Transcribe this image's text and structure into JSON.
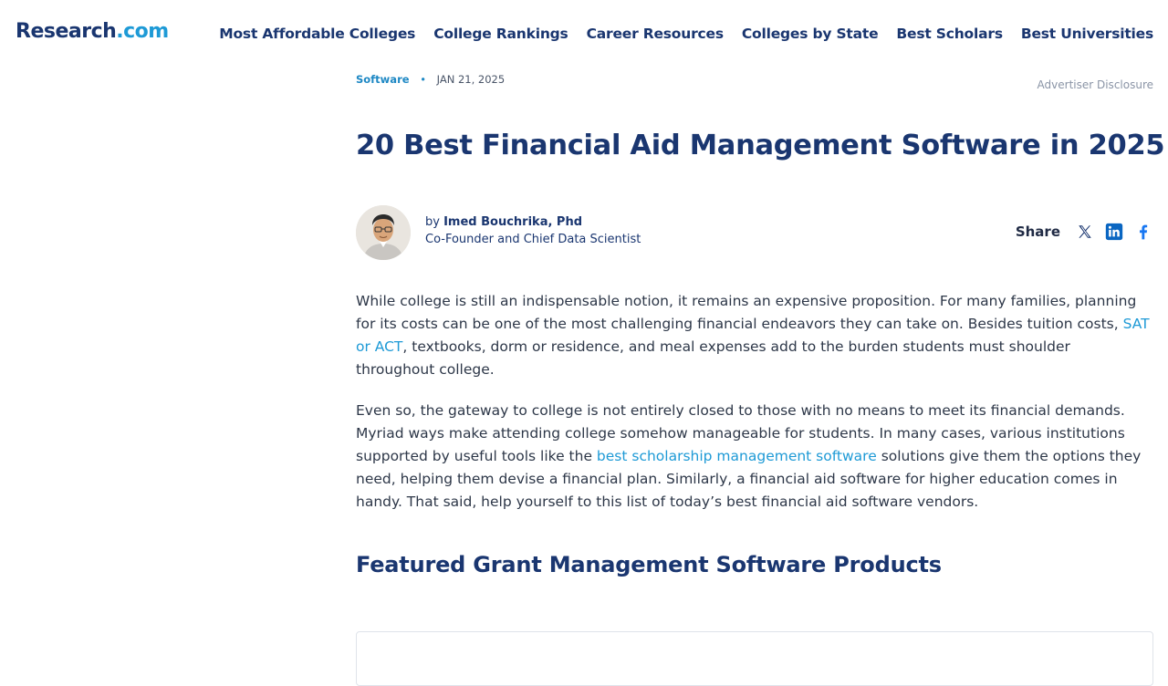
{
  "header": {
    "logo": {
      "main": "Research",
      "suffix": ".com"
    },
    "nav": [
      "Most Affordable Colleges",
      "College Rankings",
      "Career Resources",
      "Colleges by State",
      "Best Scholars",
      "Best Universities"
    ]
  },
  "article": {
    "category": "Software",
    "date": "JAN 21, 2025",
    "disclosure": "Advertiser Disclosure",
    "title": "20 Best Financial Aid Management Software in 2025",
    "author": {
      "by": "by",
      "name": "Imed Bouchrika, Phd",
      "role": "Co-Founder and Chief Data Scientist"
    },
    "share": {
      "label": "Share",
      "icons": [
        "x-twitter-icon",
        "linkedin-icon",
        "facebook-icon"
      ]
    },
    "paragraphs": {
      "p1_before": "While college is still an indispensable notion, it remains an expensive proposition. For many families, planning for its costs can be one of the most challenging financial endeavors they can take on. Besides tuition costs, ",
      "p1_link": "SAT or ACT",
      "p1_after": ", textbooks, dorm or residence, and meal expenses add to the burden students must shoulder throughout college.",
      "p2_before": "Even so, the gateway to college is not entirely closed to those with no means to meet its financial demands. Myriad ways make attending college somehow manageable for students. In many cases, various institutions supported by useful tools like the ",
      "p2_link": "best scholarship management software",
      "p2_after": " solutions give them the options they need, helping them devise a financial plan. Similarly, a financial aid software for higher education comes in handy. That said, help yourself to this list of today’s best financial aid software vendors."
    },
    "section_heading": "Featured Grant Management Software Products"
  },
  "colors": {
    "brand_navy": "#1a3670",
    "brand_blue": "#1e9ad6",
    "linkedin": "#0a66c2",
    "facebook": "#1877f2"
  }
}
